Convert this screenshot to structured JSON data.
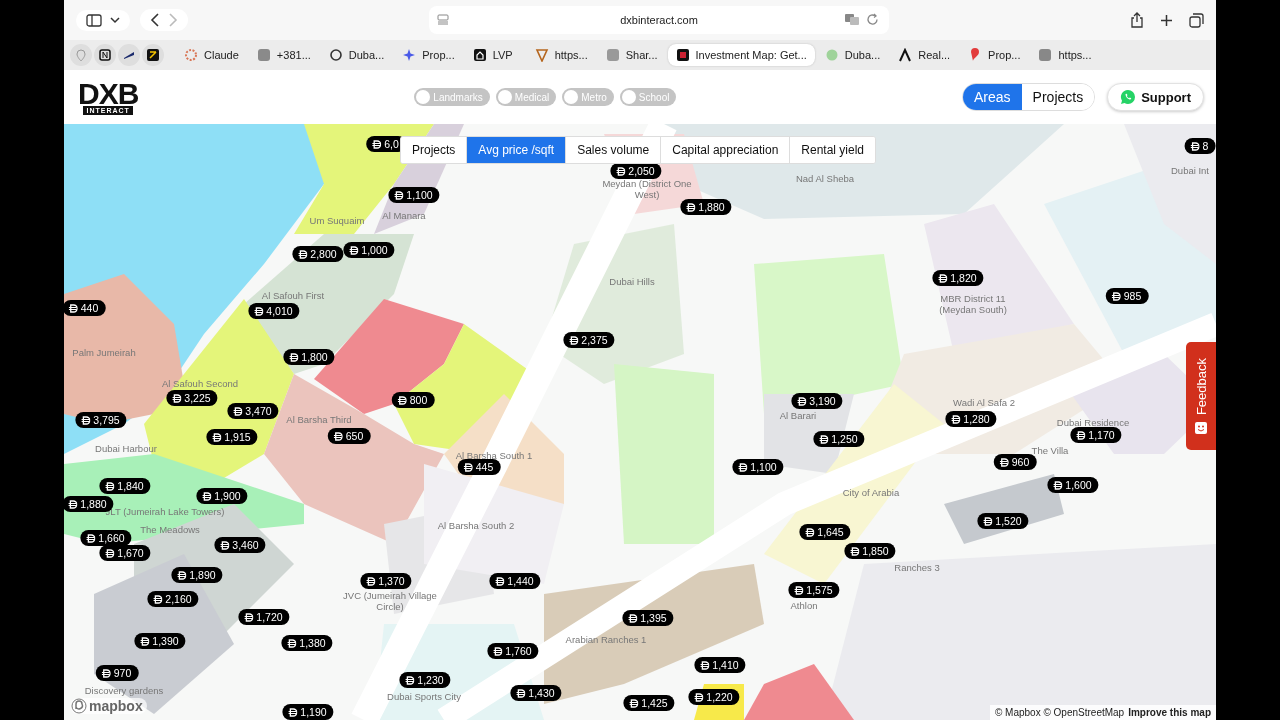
{
  "browser": {
    "address": "dxbinteract.com",
    "tabs": [
      {
        "label": "Claude",
        "selected": false
      },
      {
        "label": "+381...",
        "selected": false
      },
      {
        "label": "Duba...",
        "selected": false
      },
      {
        "label": "Prop...",
        "selected": false
      },
      {
        "label": "LVP",
        "selected": false
      },
      {
        "label": "https...",
        "selected": false
      },
      {
        "label": "Shar...",
        "selected": false
      },
      {
        "label": "Investment Map: Get...",
        "selected": true
      },
      {
        "label": "Duba...",
        "selected": false
      },
      {
        "label": "Real...",
        "selected": false
      },
      {
        "label": "Prop...",
        "selected": false
      },
      {
        "label": "https...",
        "selected": false
      }
    ]
  },
  "header": {
    "logo": {
      "main": "DXB",
      "sub": "INTERACT"
    },
    "layers": [
      {
        "label": "Landmarks",
        "on": false
      },
      {
        "label": "Medical",
        "on": false
      },
      {
        "label": "Metro",
        "on": false
      },
      {
        "label": "School",
        "on": false
      }
    ],
    "view_toggle": [
      {
        "label": "Areas",
        "selected": true
      },
      {
        "label": "Projects",
        "selected": false
      }
    ],
    "support": "Support"
  },
  "map": {
    "metric_tabs": [
      {
        "label": "Projects",
        "selected": false
      },
      {
        "label": "Avg price /sqft",
        "selected": true
      },
      {
        "label": "Sales volume",
        "selected": false
      },
      {
        "label": "Capital appreciation",
        "selected": false
      },
      {
        "label": "Rental yield",
        "selected": false
      }
    ],
    "area_labels": [
      "Meydan (District One West)",
      "Nad Al Sheba",
      "Dubai Int",
      "Um Suquaim",
      "Al Manara",
      "Al Safouh First",
      "Dubai Hills",
      "MBR District 11 (Meydan South)",
      "Palm Jumeirah",
      "Al Safouh Second",
      "Wadi Al Safa 2",
      "Al Barari",
      "Al Barsha Third",
      "Dubai Residence",
      "Dubai Harbour",
      "The Villa",
      "Al Barsha South 1",
      "City of Arabia",
      "JLT (Jumeirah Lake Towers)",
      "The Meadows",
      "Al Barsha South 2",
      "JVC (Jumeirah Village Circle)",
      "Ranches 3",
      "Athlon",
      "Arabian Ranches 1",
      "Discovery gardens",
      "Dubai Sports City"
    ],
    "price_pins": [
      "6,0",
      "1,100",
      "2,800",
      "1,000",
      "440",
      "4,010",
      "1,800",
      "3,225",
      "3,470",
      "800",
      "3,795",
      "1,915",
      "650",
      "445",
      "2,050",
      "1,880",
      "2,375",
      "1,820",
      "985",
      "3,190",
      "1,280",
      "1,250",
      "1,170",
      "1,100",
      "960",
      "1,600",
      "1,520",
      "1,645",
      "1,850",
      "1,575",
      "1,395",
      "1,410",
      "1,220",
      "1,425",
      "1,840",
      "1,880",
      "1,900",
      "1,660",
      "1,670",
      "3,460",
      "1,890",
      "2,160",
      "1,720",
      "1,390",
      "1,380",
      "970",
      "1,370",
      "1,440",
      "1,760",
      "1,230",
      "1,430",
      "1,190",
      "8"
    ],
    "feedback": "Feedback",
    "brand": "mapbox",
    "attribution": {
      "text": "© Mapbox © OpenStreetMap",
      "link": "Improve this map"
    }
  }
}
